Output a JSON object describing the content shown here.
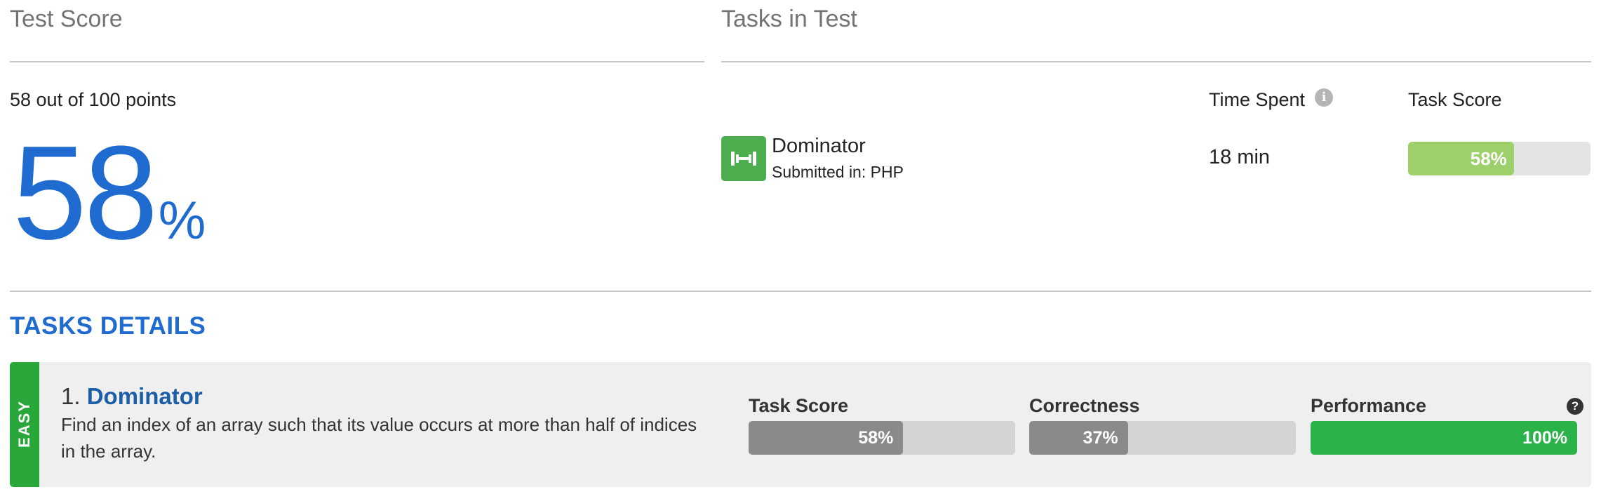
{
  "test_score": {
    "title": "Test Score",
    "points_text": "58 out of 100 points",
    "percent_value": "58",
    "percent_sign": "%"
  },
  "tasks_in_test": {
    "title": "Tasks in Test",
    "headers": {
      "time_spent": "Time Spent",
      "task_score": "Task Score"
    },
    "task": {
      "name": "Dominator",
      "submitted": "Submitted in: PHP",
      "time_spent": "18 min",
      "score_label": "58%",
      "score_fraction": 0.58,
      "icon": "dumbbell-icon"
    }
  },
  "tasks_details": {
    "title": "TASKS DETAILS",
    "items": [
      {
        "difficulty": "EASY",
        "number": "1.",
        "name": "Dominator",
        "description": "Find an index of an array such that its value occurs at more than half of indices in the array.",
        "metrics": [
          {
            "label": "Task Score",
            "value": "58%",
            "fraction": 0.58,
            "color": "#8a8a8a"
          },
          {
            "label": "Correctness",
            "value": "37%",
            "fraction": 0.37,
            "color": "#8a8a8a"
          },
          {
            "label": "Performance",
            "value": "100%",
            "fraction": 1.0,
            "color": "#2bb34a"
          }
        ]
      }
    ]
  },
  "colors": {
    "accent_blue": "#1f6bd0",
    "link_blue": "#1c5fa8",
    "score_green_light": "#9dcf6a",
    "easy_green": "#2aa73b",
    "task_icon_green": "#4cae4f"
  }
}
